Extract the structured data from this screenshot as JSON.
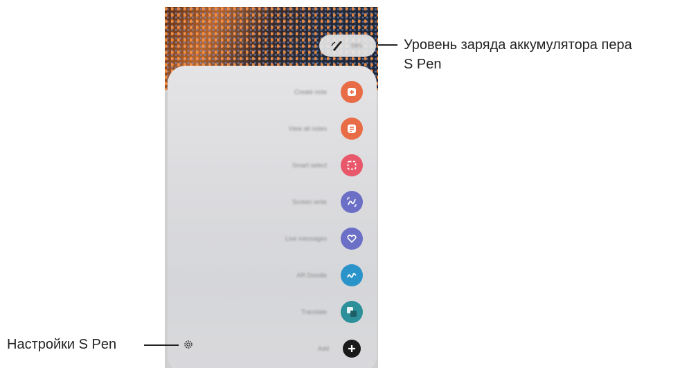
{
  "callouts": {
    "battery_level_line1": "Уровень заряда аккумулятора пера",
    "battery_level_line2": "S Pen",
    "settings": "Настройки S Pen"
  },
  "battery_chip": {
    "icon": "pen-battery-icon",
    "percent": "99%"
  },
  "air_command": {
    "items": [
      {
        "label": "Create note",
        "icon": "create-note-icon",
        "color": "#e86c45"
      },
      {
        "label": "View all notes",
        "icon": "view-all-notes-icon",
        "color": "#e86c45"
      },
      {
        "label": "Smart select",
        "icon": "smart-select-icon",
        "color": "#e8586a"
      },
      {
        "label": "Screen write",
        "icon": "screen-write-icon",
        "color": "#6b6fc6"
      },
      {
        "label": "Live messages",
        "icon": "live-messages-icon",
        "color": "#6b6fc6"
      },
      {
        "label": "AR Doodle",
        "icon": "ar-doodle-icon",
        "color": "#2a93c9"
      },
      {
        "label": "Translate",
        "icon": "translate-icon",
        "color": "#2c8f9a"
      },
      {
        "label": "Add",
        "icon": "add-icon",
        "color": "#1a1a1a"
      }
    ],
    "settings_icon": "gear-icon"
  }
}
